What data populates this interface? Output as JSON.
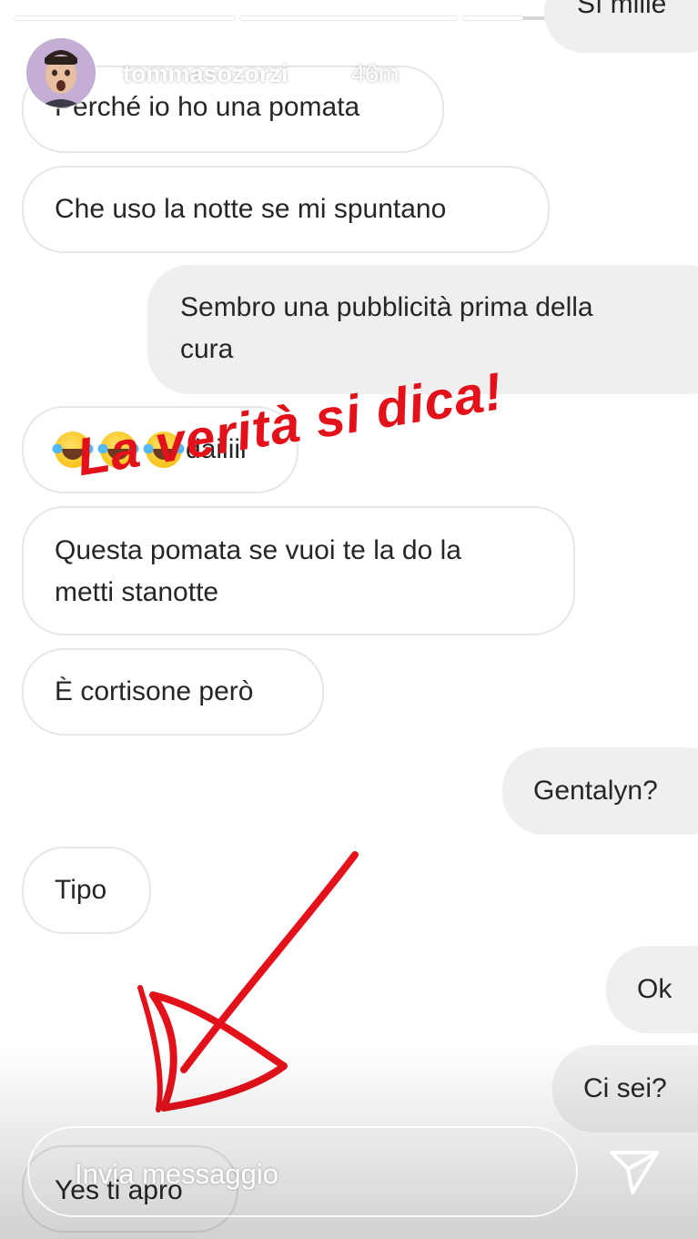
{
  "story": {
    "progress_segments": [
      {
        "fill": 1.0
      },
      {
        "fill": 1.0
      },
      {
        "fill": 0.6
      }
    ]
  },
  "header": {
    "username": "tommasozorzi",
    "time_ago": "46m",
    "more_icon": "more-horizontal-icon",
    "close_icon": "close-icon"
  },
  "messages": [
    {
      "side": "out",
      "text": "Sì mille"
    },
    {
      "side": "in",
      "text": "Perché io ho una pomata"
    },
    {
      "side": "in",
      "text": "Che uso la notte se mi spuntano"
    },
    {
      "side": "out",
      "line1": "Sembro una pubblicità prima della",
      "line2": "cura"
    },
    {
      "side": "in",
      "emoji_count": 3,
      "text": "daiiiii"
    },
    {
      "side": "in",
      "line1": "Questa pomata se vuoi te la do la",
      "line2": "metti stanotte"
    },
    {
      "side": "in",
      "text": "È cortisone però"
    },
    {
      "side": "out",
      "text": "Gentalyn?"
    },
    {
      "side": "in",
      "text": "Tipo"
    },
    {
      "side": "out",
      "text": "Ok"
    },
    {
      "side": "out",
      "text": "Ci sei?"
    },
    {
      "side": "in",
      "text": "Yes ti apro"
    }
  ],
  "overlay": {
    "caption": "La verità si dica!",
    "color": "#e3111a"
  },
  "reply": {
    "placeholder": "Invia messaggio",
    "send_icon": "send-icon"
  }
}
